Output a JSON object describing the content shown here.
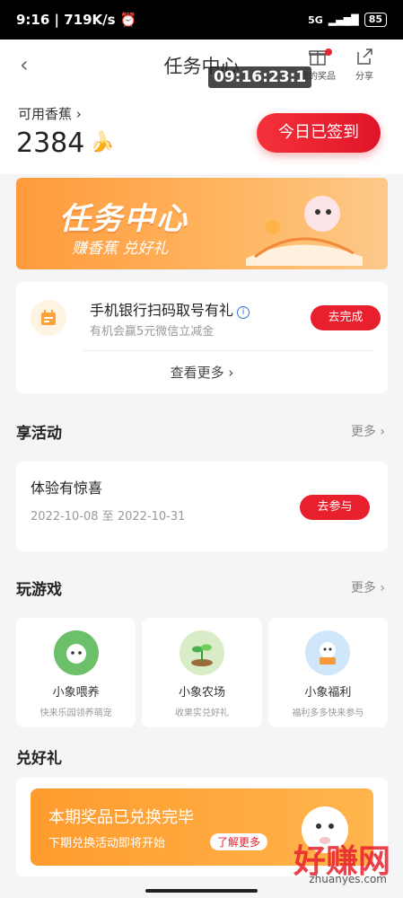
{
  "status": {
    "time": "9:16",
    "speed": "719K/s",
    "network": "5G",
    "battery": "85"
  },
  "nav": {
    "title": "任务中心",
    "prizes_label": "我的奖品",
    "share_label": "分享",
    "timer": "09:16:23:1"
  },
  "balance": {
    "label": "可用香蕉",
    "value": "2384",
    "signin_label": "今日已签到"
  },
  "banner": {
    "title": "任务中心",
    "subtitle": "赚香蕉 兑好礼"
  },
  "task": {
    "title": "手机银行扫码取号有礼",
    "subtitle": "有机会赢5元微信立减金",
    "button": "去完成",
    "more": "查看更多"
  },
  "activity": {
    "section_title": "享活动",
    "more": "更多",
    "title": "体验有惊喜",
    "date": "2022-10-08 至 2022-10-31",
    "button": "去参与"
  },
  "games": {
    "section_title": "玩游戏",
    "more": "更多",
    "items": [
      {
        "name": "小象喂养",
        "desc": "快来乐园领养萌宠"
      },
      {
        "name": "小象农场",
        "desc": "收果实兑好礼"
      },
      {
        "name": "小象福利",
        "desc": "福利多多快来参与"
      }
    ]
  },
  "gift": {
    "section_title": "兑好礼",
    "title": "本期奖品已兑换完毕",
    "subtitle": "下期兑换活动即将开始",
    "tag": "了解更多"
  },
  "watermark": {
    "text": "好赚网",
    "url": "zhuanyes.com"
  },
  "colors": {
    "accent": "#e8202e",
    "banner": "#ffa54a"
  }
}
